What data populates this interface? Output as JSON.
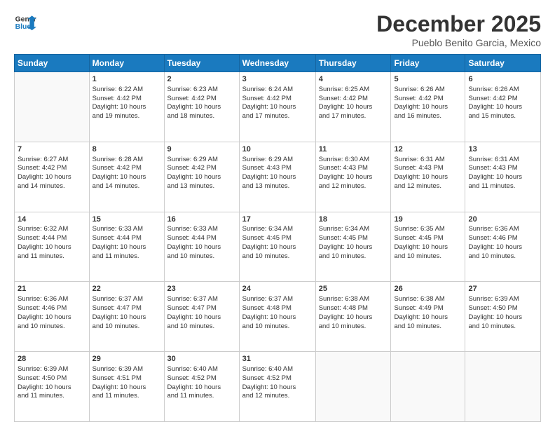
{
  "logo": {
    "line1": "General",
    "line2": "Blue"
  },
  "title": "December 2025",
  "location": "Pueblo Benito Garcia, Mexico",
  "days_header": [
    "Sunday",
    "Monday",
    "Tuesday",
    "Wednesday",
    "Thursday",
    "Friday",
    "Saturday"
  ],
  "weeks": [
    [
      {
        "num": "",
        "info": ""
      },
      {
        "num": "1",
        "info": "Sunrise: 6:22 AM\nSunset: 4:42 PM\nDaylight: 10 hours\nand 19 minutes."
      },
      {
        "num": "2",
        "info": "Sunrise: 6:23 AM\nSunset: 4:42 PM\nDaylight: 10 hours\nand 18 minutes."
      },
      {
        "num": "3",
        "info": "Sunrise: 6:24 AM\nSunset: 4:42 PM\nDaylight: 10 hours\nand 17 minutes."
      },
      {
        "num": "4",
        "info": "Sunrise: 6:25 AM\nSunset: 4:42 PM\nDaylight: 10 hours\nand 17 minutes."
      },
      {
        "num": "5",
        "info": "Sunrise: 6:26 AM\nSunset: 4:42 PM\nDaylight: 10 hours\nand 16 minutes."
      },
      {
        "num": "6",
        "info": "Sunrise: 6:26 AM\nSunset: 4:42 PM\nDaylight: 10 hours\nand 15 minutes."
      }
    ],
    [
      {
        "num": "7",
        "info": "Sunrise: 6:27 AM\nSunset: 4:42 PM\nDaylight: 10 hours\nand 14 minutes."
      },
      {
        "num": "8",
        "info": "Sunrise: 6:28 AM\nSunset: 4:42 PM\nDaylight: 10 hours\nand 14 minutes."
      },
      {
        "num": "9",
        "info": "Sunrise: 6:29 AM\nSunset: 4:42 PM\nDaylight: 10 hours\nand 13 minutes."
      },
      {
        "num": "10",
        "info": "Sunrise: 6:29 AM\nSunset: 4:43 PM\nDaylight: 10 hours\nand 13 minutes."
      },
      {
        "num": "11",
        "info": "Sunrise: 6:30 AM\nSunset: 4:43 PM\nDaylight: 10 hours\nand 12 minutes."
      },
      {
        "num": "12",
        "info": "Sunrise: 6:31 AM\nSunset: 4:43 PM\nDaylight: 10 hours\nand 12 minutes."
      },
      {
        "num": "13",
        "info": "Sunrise: 6:31 AM\nSunset: 4:43 PM\nDaylight: 10 hours\nand 11 minutes."
      }
    ],
    [
      {
        "num": "14",
        "info": "Sunrise: 6:32 AM\nSunset: 4:44 PM\nDaylight: 10 hours\nand 11 minutes."
      },
      {
        "num": "15",
        "info": "Sunrise: 6:33 AM\nSunset: 4:44 PM\nDaylight: 10 hours\nand 11 minutes."
      },
      {
        "num": "16",
        "info": "Sunrise: 6:33 AM\nSunset: 4:44 PM\nDaylight: 10 hours\nand 10 minutes."
      },
      {
        "num": "17",
        "info": "Sunrise: 6:34 AM\nSunset: 4:45 PM\nDaylight: 10 hours\nand 10 minutes."
      },
      {
        "num": "18",
        "info": "Sunrise: 6:34 AM\nSunset: 4:45 PM\nDaylight: 10 hours\nand 10 minutes."
      },
      {
        "num": "19",
        "info": "Sunrise: 6:35 AM\nSunset: 4:45 PM\nDaylight: 10 hours\nand 10 minutes."
      },
      {
        "num": "20",
        "info": "Sunrise: 6:36 AM\nSunset: 4:46 PM\nDaylight: 10 hours\nand 10 minutes."
      }
    ],
    [
      {
        "num": "21",
        "info": "Sunrise: 6:36 AM\nSunset: 4:46 PM\nDaylight: 10 hours\nand 10 minutes."
      },
      {
        "num": "22",
        "info": "Sunrise: 6:37 AM\nSunset: 4:47 PM\nDaylight: 10 hours\nand 10 minutes."
      },
      {
        "num": "23",
        "info": "Sunrise: 6:37 AM\nSunset: 4:47 PM\nDaylight: 10 hours\nand 10 minutes."
      },
      {
        "num": "24",
        "info": "Sunrise: 6:37 AM\nSunset: 4:48 PM\nDaylight: 10 hours\nand 10 minutes."
      },
      {
        "num": "25",
        "info": "Sunrise: 6:38 AM\nSunset: 4:48 PM\nDaylight: 10 hours\nand 10 minutes."
      },
      {
        "num": "26",
        "info": "Sunrise: 6:38 AM\nSunset: 4:49 PM\nDaylight: 10 hours\nand 10 minutes."
      },
      {
        "num": "27",
        "info": "Sunrise: 6:39 AM\nSunset: 4:50 PM\nDaylight: 10 hours\nand 10 minutes."
      }
    ],
    [
      {
        "num": "28",
        "info": "Sunrise: 6:39 AM\nSunset: 4:50 PM\nDaylight: 10 hours\nand 11 minutes."
      },
      {
        "num": "29",
        "info": "Sunrise: 6:39 AM\nSunset: 4:51 PM\nDaylight: 10 hours\nand 11 minutes."
      },
      {
        "num": "30",
        "info": "Sunrise: 6:40 AM\nSunset: 4:52 PM\nDaylight: 10 hours\nand 11 minutes."
      },
      {
        "num": "31",
        "info": "Sunrise: 6:40 AM\nSunset: 4:52 PM\nDaylight: 10 hours\nand 12 minutes."
      },
      {
        "num": "",
        "info": ""
      },
      {
        "num": "",
        "info": ""
      },
      {
        "num": "",
        "info": ""
      }
    ]
  ]
}
